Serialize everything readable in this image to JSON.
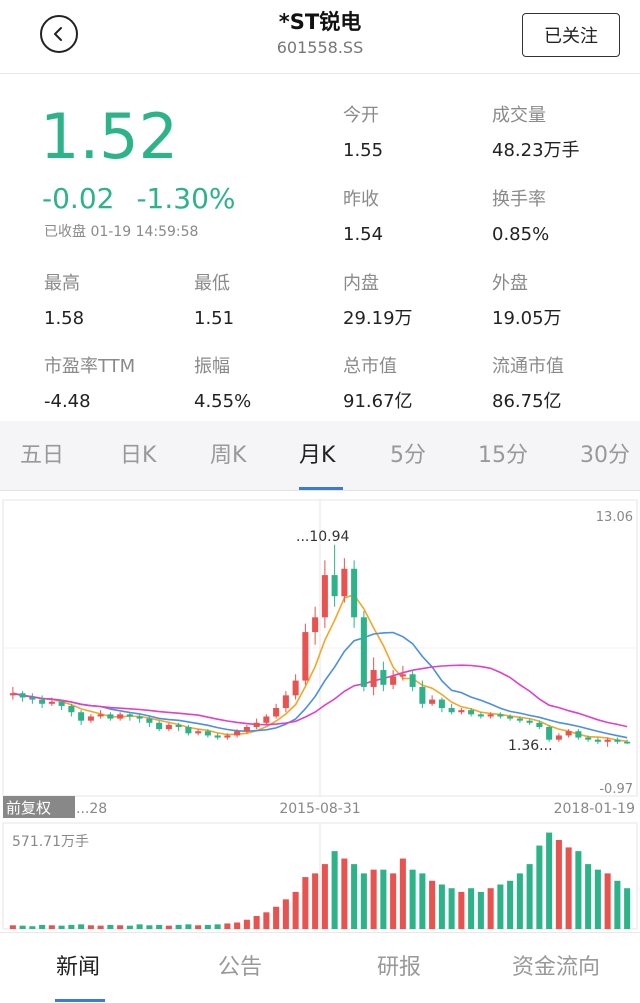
{
  "header": {
    "title": "*ST锐电",
    "code": "601558.SS",
    "follow_label": "已关注"
  },
  "quote": {
    "price": "1.52",
    "change": "-0.02",
    "change_pct": "-1.30%",
    "status": "已收盘",
    "time": "01-19 14:59:58"
  },
  "stats": [
    {
      "label": "今开",
      "value": "1.55"
    },
    {
      "label": "成交量",
      "value": "48.23万手"
    },
    {
      "label": "昨收",
      "value": "1.54"
    },
    {
      "label": "换手率",
      "value": "0.85%"
    },
    {
      "label": "最高",
      "value": "1.58"
    },
    {
      "label": "最低",
      "value": "1.51"
    },
    {
      "label": "内盘",
      "value": "29.19万"
    },
    {
      "label": "外盘",
      "value": "19.05万"
    },
    {
      "label": "市盈率TTM",
      "value": "-4.48"
    },
    {
      "label": "振幅",
      "value": "4.55%"
    },
    {
      "label": "总市值",
      "value": "91.67亿"
    },
    {
      "label": "流通市值",
      "value": "86.75亿"
    }
  ],
  "chart_tabs": [
    "五日",
    "日K",
    "周K",
    "月K",
    "5分",
    "15分",
    "30分"
  ],
  "active_chart_tab": "月K",
  "chart_labels": {
    "y_max": "13.06",
    "y_min": "-0.97",
    "high_label": "...10.94",
    "low_label": "1.36...",
    "x_left": "...28",
    "x_mid": "2015-08-31",
    "x_right": "2018-01-19",
    "adjust_label": "前复权",
    "volume_max": "571.71万手"
  },
  "colors": {
    "up": "#e8524f",
    "down": "#2db38a",
    "ma5": "#f5a623",
    "ma10": "#4a90e2",
    "ma20": "#e040c8",
    "accent": "#3a7bd5"
  },
  "bottom_tabs": [
    "新闻",
    "公告",
    "研报",
    "资金流向"
  ],
  "active_bottom_tab": "新闻",
  "chart_data": {
    "type": "candlestick",
    "period": "monthly",
    "ylim": [
      -0.97,
      13.06
    ],
    "x_ticks": [
      "...28",
      "2015-08-31",
      "2018-01-19"
    ],
    "annotations": [
      {
        "label": "...10.94",
        "value": 10.94
      },
      {
        "label": "1.36...",
        "value": 1.36
      }
    ],
    "candles": [
      [
        3.8,
        3.9,
        3.6,
        4.2
      ],
      [
        3.9,
        3.7,
        3.5,
        4.0
      ],
      [
        3.7,
        3.6,
        3.4,
        3.9
      ],
      [
        3.6,
        3.4,
        3.2,
        3.8
      ],
      [
        3.4,
        3.5,
        3.3,
        3.7
      ],
      [
        3.5,
        3.3,
        3.1,
        3.6
      ],
      [
        3.3,
        3.0,
        2.8,
        3.4
      ],
      [
        3.0,
        2.6,
        2.4,
        3.1
      ],
      [
        2.6,
        2.8,
        2.5,
        2.9
      ],
      [
        2.8,
        2.9,
        2.7,
        3.1
      ],
      [
        2.9,
        2.7,
        2.6,
        3.0
      ],
      [
        2.7,
        2.9,
        2.6,
        3.0
      ],
      [
        2.9,
        2.8,
        2.6,
        3.0
      ],
      [
        2.8,
        2.7,
        2.5,
        2.9
      ],
      [
        2.7,
        2.5,
        2.3,
        2.8
      ],
      [
        2.5,
        2.2,
        2.1,
        2.6
      ],
      [
        2.2,
        2.4,
        2.1,
        2.5
      ],
      [
        2.4,
        2.3,
        2.1,
        2.5
      ],
      [
        2.3,
        2.0,
        1.9,
        2.4
      ],
      [
        2.0,
        2.1,
        1.9,
        2.2
      ],
      [
        2.1,
        1.9,
        1.8,
        2.2
      ],
      [
        1.9,
        1.8,
        1.7,
        2.0
      ],
      [
        1.8,
        1.9,
        1.7,
        2.0
      ],
      [
        1.9,
        2.1,
        1.8,
        2.2
      ],
      [
        2.1,
        2.3,
        2.0,
        2.4
      ],
      [
        2.3,
        2.5,
        2.2,
        2.7
      ],
      [
        2.5,
        2.8,
        2.4,
        2.9
      ],
      [
        2.8,
        3.2,
        2.7,
        3.4
      ],
      [
        3.2,
        3.8,
        3.0,
        4.0
      ],
      [
        3.8,
        4.5,
        3.6,
        4.8
      ],
      [
        4.5,
        6.8,
        4.3,
        7.2
      ],
      [
        6.8,
        7.5,
        6.2,
        8.0
      ],
      [
        7.5,
        9.5,
        7.0,
        10.2
      ],
      [
        9.5,
        8.5,
        8.0,
        10.94
      ],
      [
        8.5,
        9.8,
        8.2,
        10.3
      ],
      [
        9.8,
        7.5,
        7.0,
        10.2
      ],
      [
        7.5,
        4.2,
        4.0,
        7.8
      ],
      [
        4.2,
        5.0,
        3.8,
        5.6
      ],
      [
        5.0,
        4.3,
        4.0,
        5.4
      ],
      [
        4.3,
        4.7,
        4.1,
        5.0
      ],
      [
        4.7,
        4.8,
        4.5,
        5.2
      ],
      [
        4.8,
        4.2,
        4.0,
        5.0
      ],
      [
        4.2,
        3.4,
        3.2,
        4.5
      ],
      [
        3.4,
        3.6,
        3.3,
        3.8
      ],
      [
        3.6,
        3.2,
        3.0,
        3.7
      ],
      [
        3.2,
        3.0,
        2.9,
        3.4
      ],
      [
        3.0,
        3.1,
        2.9,
        3.2
      ],
      [
        3.1,
        2.9,
        2.8,
        3.2
      ],
      [
        2.9,
        2.8,
        2.7,
        3.0
      ],
      [
        2.8,
        2.9,
        2.7,
        3.0
      ],
      [
        2.9,
        2.8,
        2.7,
        3.0
      ],
      [
        2.8,
        2.7,
        2.6,
        2.9
      ],
      [
        2.7,
        2.6,
        2.5,
        2.8
      ],
      [
        2.6,
        2.5,
        2.4,
        2.7
      ],
      [
        2.5,
        2.3,
        2.2,
        2.6
      ],
      [
        2.3,
        1.7,
        1.6,
        2.4
      ],
      [
        1.7,
        1.9,
        1.6,
        2.0
      ],
      [
        1.9,
        2.1,
        1.8,
        2.2
      ],
      [
        2.1,
        1.8,
        1.7,
        2.2
      ],
      [
        1.8,
        1.7,
        1.6,
        1.9
      ],
      [
        1.7,
        1.6,
        1.5,
        1.8
      ],
      [
        1.6,
        1.7,
        1.36,
        1.8
      ],
      [
        1.7,
        1.6,
        1.5,
        1.8
      ],
      [
        1.6,
        1.52,
        1.5,
        1.7
      ]
    ],
    "volume_unit": "万手",
    "volume_max": 571.71,
    "volumes": [
      20,
      18,
      15,
      22,
      20,
      18,
      22,
      25,
      20,
      18,
      22,
      20,
      18,
      25,
      20,
      22,
      18,
      22,
      25,
      20,
      22,
      25,
      30,
      35,
      50,
      70,
      90,
      120,
      160,
      200,
      280,
      300,
      350,
      420,
      380,
      350,
      300,
      320,
      320,
      300,
      380,
      320,
      300,
      260,
      240,
      220,
      200,
      220,
      200,
      220,
      240,
      260,
      300,
      350,
      450,
      520,
      480,
      440,
      420,
      350,
      320,
      300,
      260,
      220,
      180
    ]
  }
}
